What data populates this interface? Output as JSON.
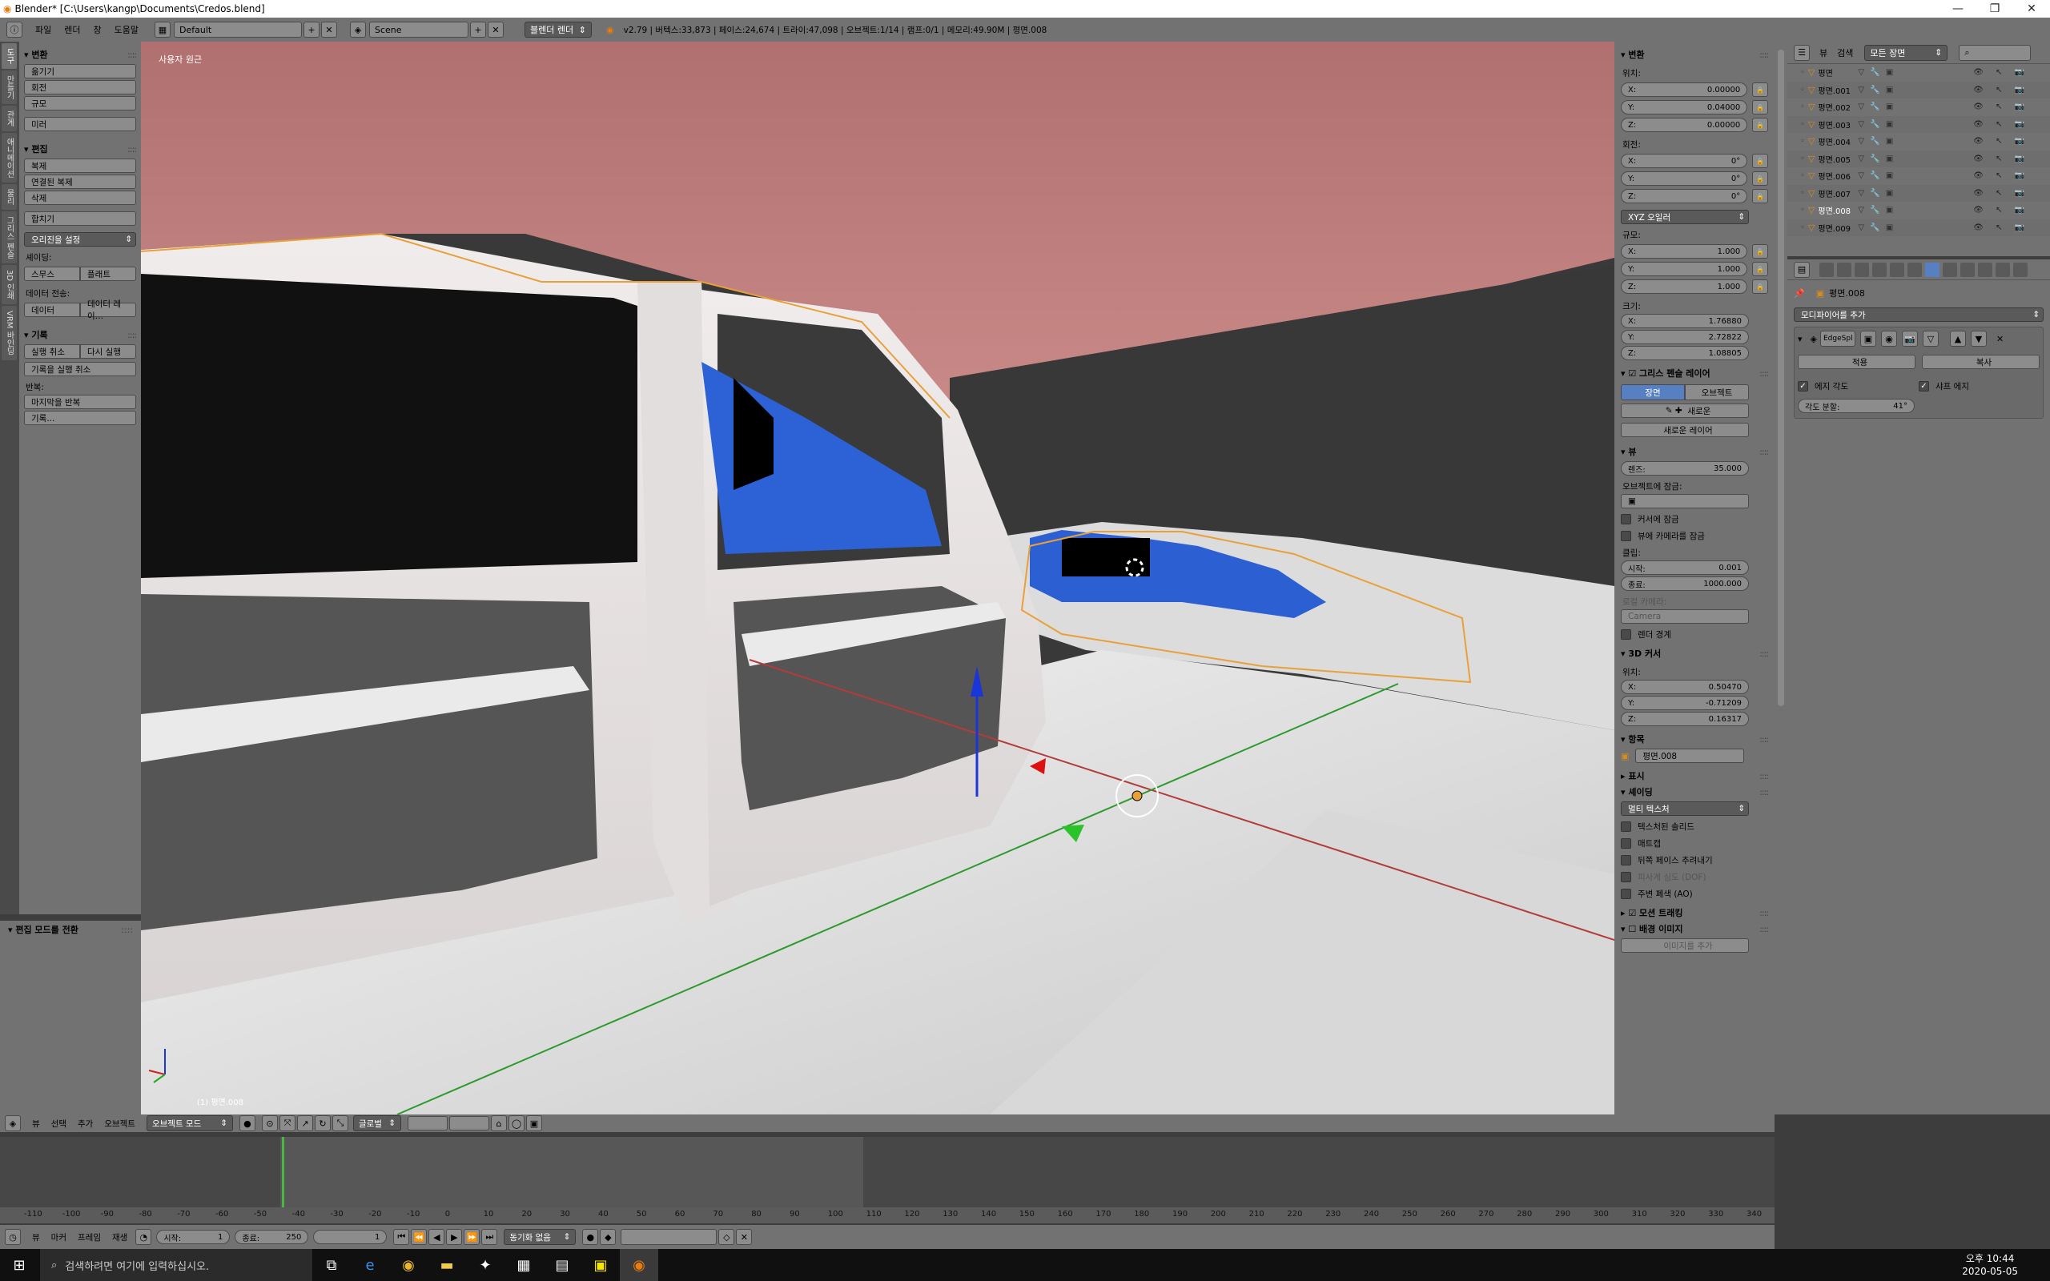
{
  "window": {
    "title": "Blender* [C:\\Users\\kangp\\Documents\\Credos.blend]"
  },
  "infobar": {
    "menus": [
      "파일",
      "렌더",
      "창",
      "도움말"
    ],
    "screen": "Default",
    "scene": "Scene",
    "engine": "블렌더 렌더",
    "stats": "v2.79 | 버텍스:33,873 | 페이스:24,674 | 트라이:47,098 | 오브젝트:1/14 | 램프:0/1 | 메모리:49.90M | 평면.008"
  },
  "left_tabs": [
    "도구",
    "만들기",
    "관계",
    "애니메이션",
    "물리",
    "그리스 펜슬",
    "3D 인쇄",
    "VRM 바인딩"
  ],
  "shelf": {
    "transform": {
      "title": "변환",
      "buttons": [
        "옮기기",
        "회전",
        "규모",
        "미러"
      ]
    },
    "edit": {
      "title": "편집",
      "buttons": [
        "복제",
        "연결된 복제",
        "삭제",
        "합치기"
      ],
      "origin": "오리진을 설정",
      "shading_label": "셰이딩:",
      "smooth": "스무스",
      "flat": "플래트",
      "data_label": "데이터 전송:",
      "data": "데이터",
      "data_layout": "데이터 레이…"
    },
    "history": {
      "title": "기록",
      "undo": "실행 취소",
      "redo": "다시 실행",
      "undo_history": "기록을 실행 취소",
      "repeat_label": "반복:",
      "repeat_last": "마지막을 반복",
      "history": "기록..."
    }
  },
  "operator_panel": "편집 모드를 전환",
  "viewport": {
    "label": "사용자 원근",
    "object_label": "(1) 평면.008"
  },
  "rprops": {
    "transform_title": "변환",
    "location_label": "위치:",
    "location": [
      {
        "a": "X:",
        "v": "0.00000"
      },
      {
        "a": "Y:",
        "v": "0.04000"
      },
      {
        "a": "Z:",
        "v": "0.00000"
      }
    ],
    "rotation_label": "회전:",
    "rotation": [
      {
        "a": "X:",
        "v": "0°"
      },
      {
        "a": "Y:",
        "v": "0°"
      },
      {
        "a": "Z:",
        "v": "0°"
      }
    ],
    "rotation_mode": "XYZ 오일러",
    "scale_label": "규모:",
    "scale": [
      {
        "a": "X:",
        "v": "1.000"
      },
      {
        "a": "Y:",
        "v": "1.000"
      },
      {
        "a": "Z:",
        "v": "1.000"
      }
    ],
    "dims_label": "크기:",
    "dims": [
      {
        "a": "X:",
        "v": "1.76880"
      },
      {
        "a": "Y:",
        "v": "2.72822"
      },
      {
        "a": "Z:",
        "v": "1.08805"
      }
    ],
    "gp_title": "그리스 펜슬 레이어",
    "gp_scene": "장면",
    "gp_object": "오브젝트",
    "gp_new": "새로운",
    "gp_new_layer": "새로운 레이어",
    "view_title": "뷰",
    "lens_label": "렌즈:",
    "lens": "35.000",
    "lock_to_object": "오브젝트에 잠금:",
    "lock_cursor": "커서에 잠금",
    "lock_camera": "뷰에 카메라를 잠금",
    "clip_label": "클립:",
    "clip_start_l": "시작:",
    "clip_start": "0.001",
    "clip_end_l": "종료:",
    "clip_end": "1000.000",
    "local_camera": "로컬 카메라:",
    "camera": "Camera",
    "render_border": "렌더 경계",
    "cursor_title": "3D 커서",
    "cursor_loc_label": "위치:",
    "cursor": [
      {
        "a": "X:",
        "v": "0.50470"
      },
      {
        "a": "Y:",
        "v": "-0.71209"
      },
      {
        "a": "Z:",
        "v": "0.16317"
      }
    ],
    "item_title": "항목",
    "item_name": "평면.008",
    "display_title": "표시",
    "shading_title": "셰이딩",
    "shading_mode": "멀티 텍스처",
    "shading_opts": [
      "텍스처된 솔리드",
      "매트캡",
      "뒤쪽 페이스 추려내기",
      "피사계 심도 (DOF)",
      "주변 폐색 (AO)"
    ],
    "motion_tracking": "모션 트래킹",
    "bg_image": "배경 이미지",
    "add_image": "이미지를 추가"
  },
  "outliner": {
    "search_label": "검색",
    "view": "모든 장면",
    "items": [
      "평면",
      "평면.001",
      "평면.002",
      "평면.003",
      "평면.004",
      "평면.005",
      "평면.006",
      "평면.007",
      "평면.008",
      "평면.009"
    ]
  },
  "props": {
    "object": "평면.008",
    "add_modifier": "모디파이어를 추가",
    "modifier_name": "EdgeSpl",
    "apply": "적용",
    "copy": "복사",
    "edge_angle": "에지 각도",
    "sharp_edges": "샤프 에지",
    "split_angle_label": "각도 분할:",
    "split_angle": "41°"
  },
  "vpheader": {
    "menus": [
      "뷰",
      "선택",
      "추가",
      "오브젝트"
    ],
    "mode": "오브젝트 모드",
    "orientation": "글로벌"
  },
  "timeline": {
    "ticks": [
      "-110",
      "-100",
      "-90",
      "-80",
      "-70",
      "-60",
      "-50",
      "-40",
      "-30",
      "-20",
      "-10",
      "0",
      "10",
      "20",
      "30",
      "40",
      "50",
      "60",
      "70",
      "80",
      "90",
      "100",
      "110",
      "120",
      "130",
      "140",
      "150",
      "160",
      "170",
      "180",
      "190",
      "200",
      "210",
      "220",
      "230",
      "240",
      "250",
      "260",
      "270",
      "280",
      "290",
      "300",
      "310",
      "320",
      "330",
      "340"
    ],
    "menus": [
      "뷰",
      "마커",
      "프레임",
      "재생"
    ],
    "start_l": "시작:",
    "start": "1",
    "end_l": "종료:",
    "end": "250",
    "current": "1",
    "sync": "동기화 없음"
  },
  "taskbar": {
    "search": "검색하려면 여기에 입력하십시오.",
    "time": "오후 10:44",
    "date": "2020-05-05"
  }
}
